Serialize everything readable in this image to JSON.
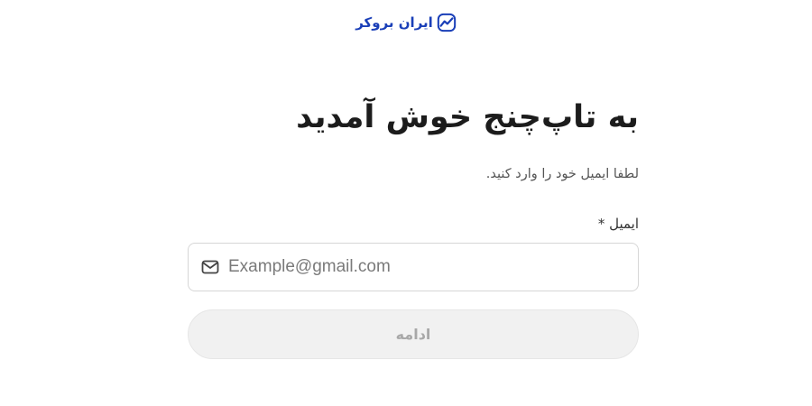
{
  "brand": {
    "logo_text": "ایران بروکر",
    "logo_icon": "chart-line-logo-icon",
    "color": "#1a3fb8"
  },
  "page": {
    "title": "به تاپ‌چنج خوش آمدید",
    "subtitle": "لطفا ایمیل خود را وارد کنید."
  },
  "form": {
    "email_label": "ایمیل *",
    "email_placeholder": "Example@gmail.com",
    "email_value": "",
    "email_icon": "mail-icon",
    "submit_label": "ادامه",
    "submit_disabled": true
  },
  "colors": {
    "title": "#1c1c1c",
    "subtitle": "#555555",
    "input_border": "#d6d6d6",
    "button_bg_disabled": "#f1f1f1",
    "button_text_disabled": "#a8a8a8"
  }
}
